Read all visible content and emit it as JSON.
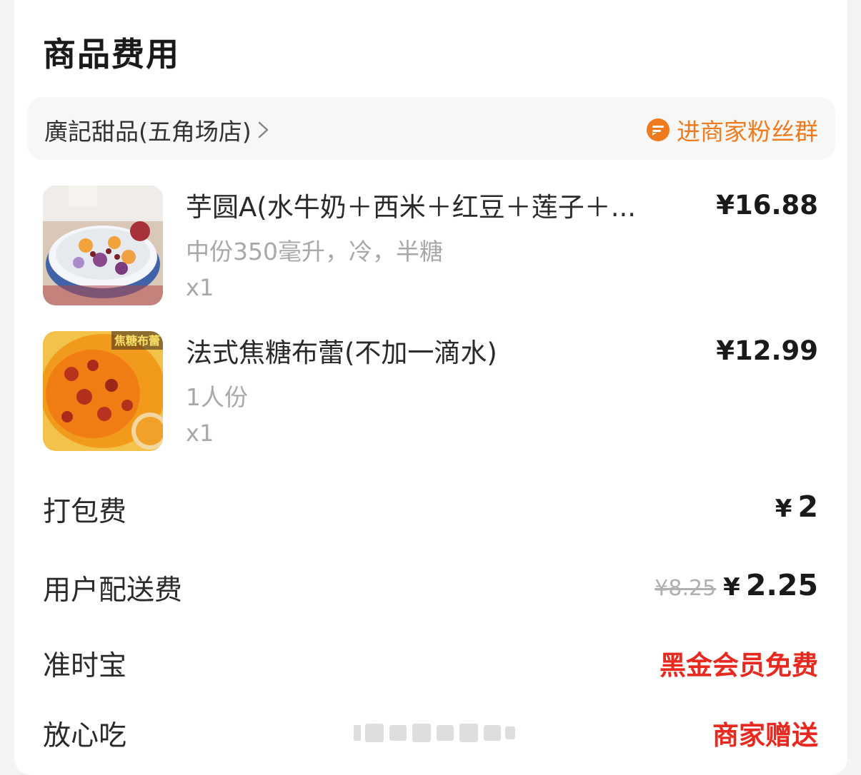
{
  "section": {
    "title": "商品费用"
  },
  "store": {
    "name": "廣記甜品(五角场店)",
    "fans_group_label": "进商家粉丝群",
    "accent_color": "#f07a1e"
  },
  "items": [
    {
      "name": "芋圆A(水牛奶＋西米＋红豆＋莲子＋...",
      "spec": "中份350毫升，冷，半糖",
      "qty": "x1",
      "price": "¥16.88",
      "thumb_icon": "taro-ball-dessert-image"
    },
    {
      "name": "法式焦糖布蕾(不加一滴水)",
      "spec": "1人份",
      "qty": "x1",
      "price": "¥12.99",
      "thumb_icon": "creme-brulee-image",
      "thumb_caption": "焦糖布蕾"
    }
  ],
  "fees": {
    "packing": {
      "label": "打包费",
      "currency": "¥",
      "value": "2"
    },
    "delivery": {
      "label": "用户配送费",
      "original": "¥8.25",
      "currency": "¥",
      "value": "2.25"
    },
    "on_time": {
      "label": "准时宝",
      "value": "黑金会员免费"
    },
    "safe_eat": {
      "label": "放心吃",
      "value": "商家赠送"
    }
  },
  "colors": {
    "promo_red": "#e8291f",
    "muted_gray": "#a8a8a8"
  }
}
